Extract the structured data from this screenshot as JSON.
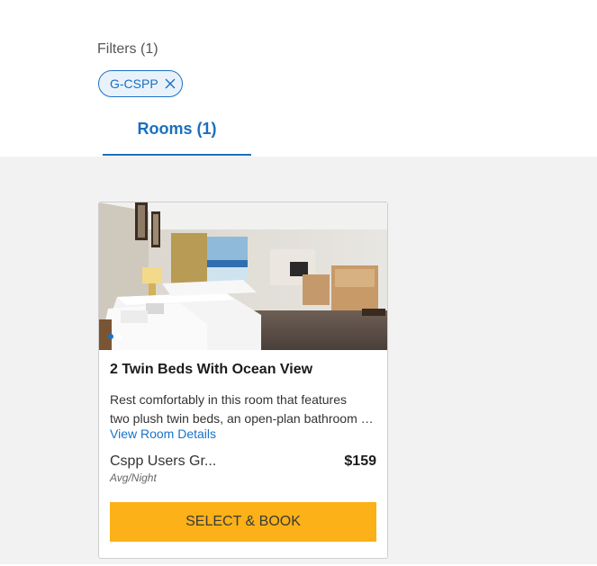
{
  "filters": {
    "label": "Filters (1)",
    "chips": [
      {
        "label": "G-CSPP",
        "close_icon": "close-icon"
      }
    ]
  },
  "tabs": [
    {
      "label": "Rooms (1)",
      "active": true
    }
  ],
  "room_card": {
    "image_alt": "Hotel room with two twin beds and ocean view",
    "carousel": {
      "total": 2,
      "active_index": 0
    },
    "title": "2 Twin Beds With Ocean View",
    "description_line1": "Rest comfortably in this room that features",
    "description_line2": "two plush twin beds, an open-plan bathroom and",
    "details_link": "View Room Details",
    "rate_name": "Cspp Users Gr...",
    "rate_subtext": "Avg/Night",
    "price": "$159",
    "book_button": "SELECT & BOOK"
  },
  "colors": {
    "accent": "#1a73c7",
    "book_button": "#fbb117",
    "content_bg": "#f2f2f2"
  }
}
